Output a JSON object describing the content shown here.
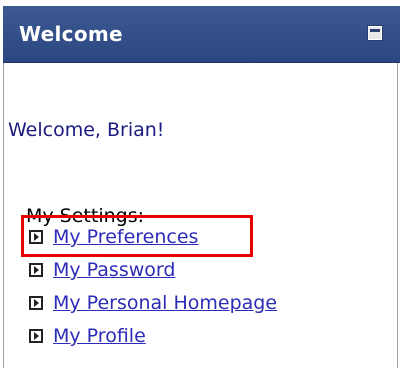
{
  "portlet": {
    "title": "Welcome"
  },
  "greeting": "Welcome, Brian!",
  "settings_label": "My Settings:",
  "links": [
    {
      "label": "My Preferences"
    },
    {
      "label": "My Password"
    },
    {
      "label": "My Personal Homepage"
    },
    {
      "label": "My Profile"
    }
  ],
  "colors": {
    "titlebar": "#2f4b86",
    "link": "#2c2cb8",
    "greeting": "#1a1a80",
    "highlight": "#e80000"
  }
}
